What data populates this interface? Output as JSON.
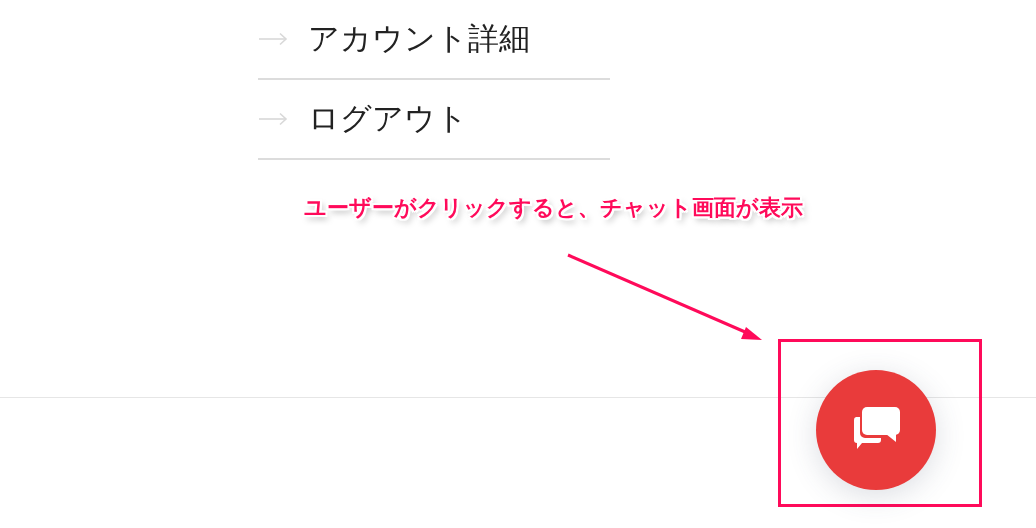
{
  "menu": {
    "items": [
      {
        "label": "アカウント詳細"
      },
      {
        "label": "ログアウト"
      }
    ]
  },
  "annotation": {
    "text": "ユーザーがクリックすると、チャット画面が表示"
  },
  "chat_button": {
    "kind": "chat"
  }
}
